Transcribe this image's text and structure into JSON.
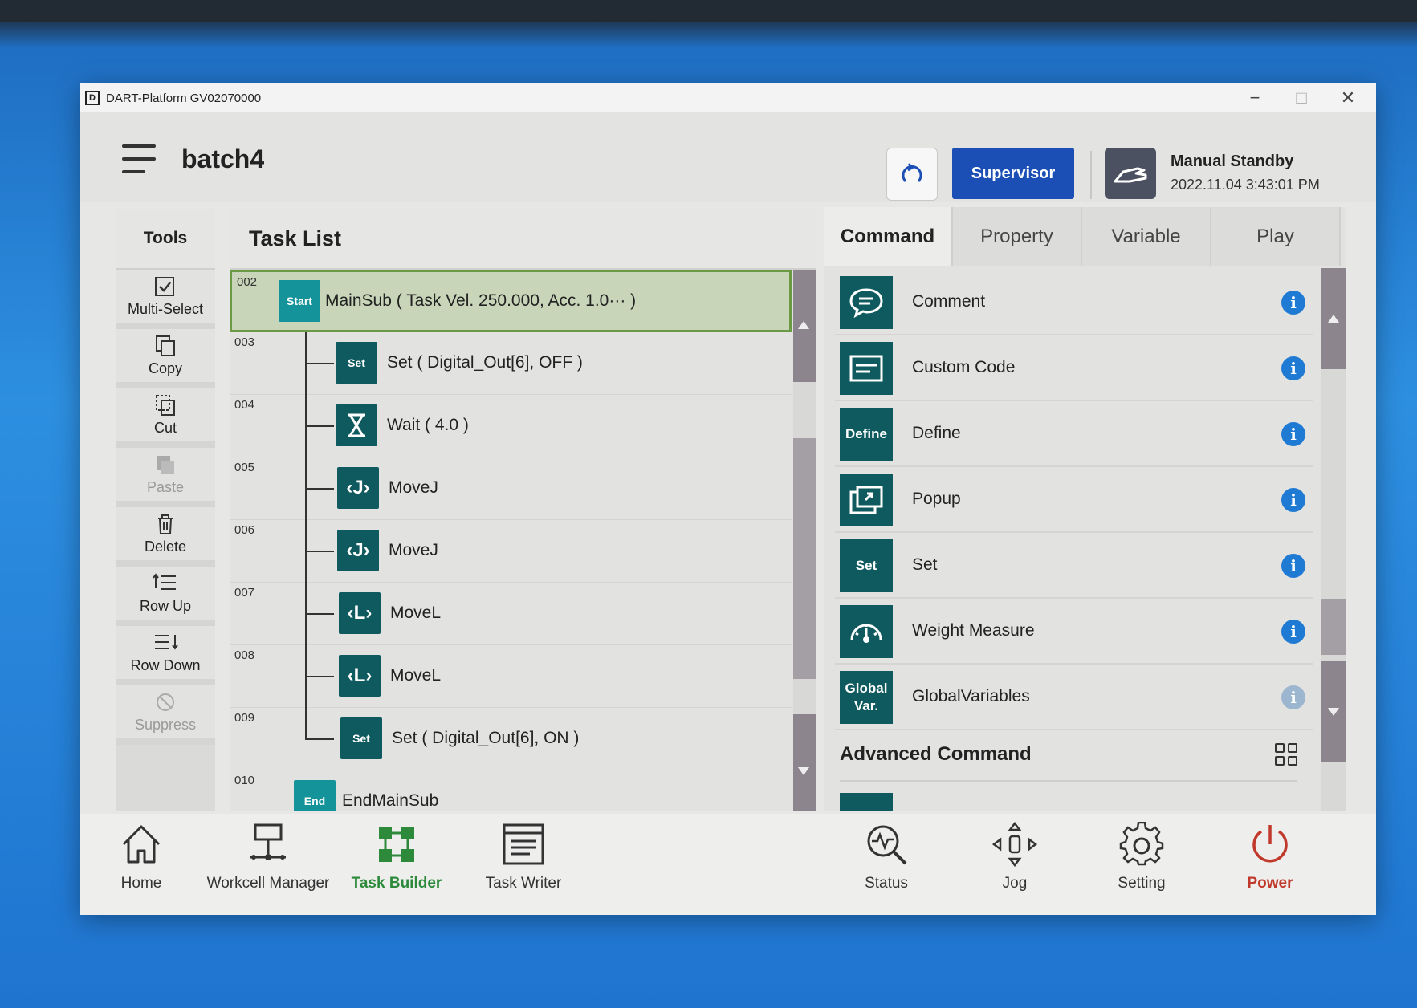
{
  "window": {
    "title": "DART-Platform GV02070000",
    "minimize": "−",
    "maximize": "□",
    "close": "✕"
  },
  "header": {
    "task_name": "batch4",
    "role_button": "Supervisor",
    "status": "Manual Standby",
    "datetime": "2022.11.04 3:43:01 PM"
  },
  "tools": {
    "title": "Tools",
    "items": [
      {
        "label": "Multi-Select",
        "icon": "multi-select-icon",
        "enabled": true
      },
      {
        "label": "Copy",
        "icon": "copy-icon",
        "enabled": true
      },
      {
        "label": "Cut",
        "icon": "cut-icon",
        "enabled": true
      },
      {
        "label": "Paste",
        "icon": "paste-icon",
        "enabled": false
      },
      {
        "label": "Delete",
        "icon": "trash-icon",
        "enabled": true
      },
      {
        "label": "Row Up",
        "icon": "row-up-icon",
        "enabled": true
      },
      {
        "label": "Row Down",
        "icon": "row-down-icon",
        "enabled": true
      },
      {
        "label": "Suppress",
        "icon": "suppress-icon",
        "enabled": false
      }
    ]
  },
  "task_list": {
    "title": "Task List",
    "rows": [
      {
        "num": "002",
        "icon": "Start",
        "text": "MainSub  ( Task Vel. 250.000, Acc. 1.0··· )",
        "selected": true
      },
      {
        "num": "003",
        "icon": "Set",
        "text": "Set  ( Digital_Out[6], OFF )"
      },
      {
        "num": "004",
        "icon": "wait-icon",
        "text": "Wait  ( 4.0 )"
      },
      {
        "num": "005",
        "icon": "movej-icon",
        "text": "MoveJ"
      },
      {
        "num": "006",
        "icon": "movej-icon",
        "text": "MoveJ"
      },
      {
        "num": "007",
        "icon": "movel-icon",
        "text": "MoveL"
      },
      {
        "num": "008",
        "icon": "movel-icon",
        "text": "MoveL"
      },
      {
        "num": "009",
        "icon": "Set",
        "text": "Set  ( Digital_Out[6], ON )"
      },
      {
        "num": "010",
        "icon": "End",
        "text": "EndMainSub"
      }
    ]
  },
  "right_panel": {
    "tabs": [
      "Command",
      "Property",
      "Variable",
      "Play"
    ],
    "active_tab": "Command",
    "commands": [
      {
        "label": "Comment",
        "icon": "comment-icon",
        "icon_text": ""
      },
      {
        "label": "Custom Code",
        "icon": "custom-code-icon",
        "icon_text": ""
      },
      {
        "label": "Define",
        "icon": "define-icon",
        "icon_text": "Define"
      },
      {
        "label": "Popup",
        "icon": "popup-icon",
        "icon_text": ""
      },
      {
        "label": "Set",
        "icon": "set-icon",
        "icon_text": "Set"
      },
      {
        "label": "Weight Measure",
        "icon": "gauge-icon",
        "icon_text": ""
      },
      {
        "label": "GlobalVariables",
        "icon": "global-var-icon",
        "icon_text": "Global Var."
      }
    ],
    "info_glyph": "i",
    "advanced_title": "Advanced Command"
  },
  "bottom_nav": {
    "items": [
      {
        "label": "Home",
        "icon": "home-icon"
      },
      {
        "label": "Workcell Manager",
        "icon": "workcell-icon"
      },
      {
        "label": "Task Builder",
        "icon": "task-builder-icon",
        "active": true
      },
      {
        "label": "Task Writer",
        "icon": "task-writer-icon"
      },
      {
        "label": "Status",
        "icon": "status-icon"
      },
      {
        "label": "Jog",
        "icon": "jog-icon"
      },
      {
        "label": "Setting",
        "icon": "gear-icon"
      },
      {
        "label": "Power",
        "icon": "power-icon"
      }
    ]
  },
  "colors": {
    "accent_blue": "#1c4fb5",
    "command_teal": "#0f5a5e",
    "start_end_teal": "#15939b",
    "selected_row": "#c8d5b8",
    "active_nav": "#2c8a3a",
    "power_red": "#c0392b"
  }
}
